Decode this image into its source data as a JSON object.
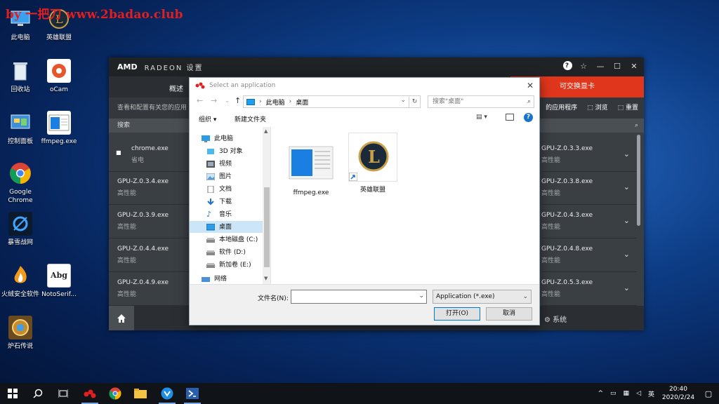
{
  "watermark": "by 一把刀 www.2badao.club",
  "desktop": {
    "icons": [
      {
        "label": "此电脑"
      },
      {
        "label": "英雄联盟"
      },
      {
        "label": "回收站"
      },
      {
        "label": "oCam"
      },
      {
        "label": "控制面板"
      },
      {
        "label": "ffmpeg.exe"
      },
      {
        "label": "Google Chrome"
      },
      {
        "label": "暴雪战网"
      },
      {
        "label": "火绒安全软件"
      },
      {
        "label": "NotoSerif..."
      },
      {
        "label": "炉石传说"
      }
    ],
    "notoserif_glyph": "Abg"
  },
  "amd": {
    "logo": "AMD",
    "title": "RADEON 设置",
    "tab_overview": "概述",
    "tab_switchable": "可交换显卡",
    "subtitle": "查看和配置有关您的应用",
    "sub_right_text": "的应用程序",
    "browse": "浏览",
    "reset": "重置",
    "search_label": "搜索",
    "left_rows": [
      {
        "name": "chrome.exe",
        "status": "省电"
      },
      {
        "name": "GPU-Z.0.3.4.exe",
        "status": "高性能"
      },
      {
        "name": "GPU-Z.0.3.9.exe",
        "status": "高性能"
      },
      {
        "name": "GPU-Z.0.4.4.exe",
        "status": "高性能"
      },
      {
        "name": "GPU-Z.0.4.9.exe",
        "status": "高性能"
      }
    ],
    "right_rows": [
      {
        "name": "GPU-Z.0.3.3.exe",
        "status": "高性能"
      },
      {
        "name": "GPU-Z.0.3.8.exe",
        "status": "高性能"
      },
      {
        "name": "GPU-Z.0.4.3.exe",
        "status": "高性能"
      },
      {
        "name": "GPU-Z.0.4.8.exe",
        "status": "高性能"
      },
      {
        "name": "GPU-Z.0.5.3.exe",
        "status": "高性能"
      }
    ],
    "system_label": "系统"
  },
  "dialog": {
    "title": "Select an application",
    "breadcrumb": [
      "此电脑",
      "桌面"
    ],
    "search_placeholder": "搜索\"桌面\"",
    "organize": "组织 ▾",
    "new_folder": "新建文件夹",
    "tree": [
      {
        "label": "此电脑",
        "icon": "pc-icon"
      },
      {
        "label": "3D 对象",
        "icon": "3d-objects-icon"
      },
      {
        "label": "视频",
        "icon": "video-icon"
      },
      {
        "label": "图片",
        "icon": "pictures-icon"
      },
      {
        "label": "文档",
        "icon": "documents-icon"
      },
      {
        "label": "下载",
        "icon": "downloads-icon"
      },
      {
        "label": "音乐",
        "icon": "music-icon"
      },
      {
        "label": "桌面",
        "icon": "desktop-icon"
      },
      {
        "label": "本地磁盘 (C:)",
        "icon": "drive-icon"
      },
      {
        "label": "软件 (D:)",
        "icon": "drive-icon"
      },
      {
        "label": "新加卷 (E:)",
        "icon": "drive-icon"
      },
      {
        "label": "网络",
        "icon": "network-icon"
      }
    ],
    "files": [
      {
        "name": "ffmpeg.exe"
      },
      {
        "name": "英雄联盟"
      }
    ],
    "filename_label": "文件名(N):",
    "filename_value": "",
    "filetype": "Application (*.exe)",
    "open_button": "打开(O)",
    "cancel_button": "取消"
  },
  "taskbar": {
    "time": "20:40",
    "date": "2020/2/24",
    "ime": "英"
  }
}
